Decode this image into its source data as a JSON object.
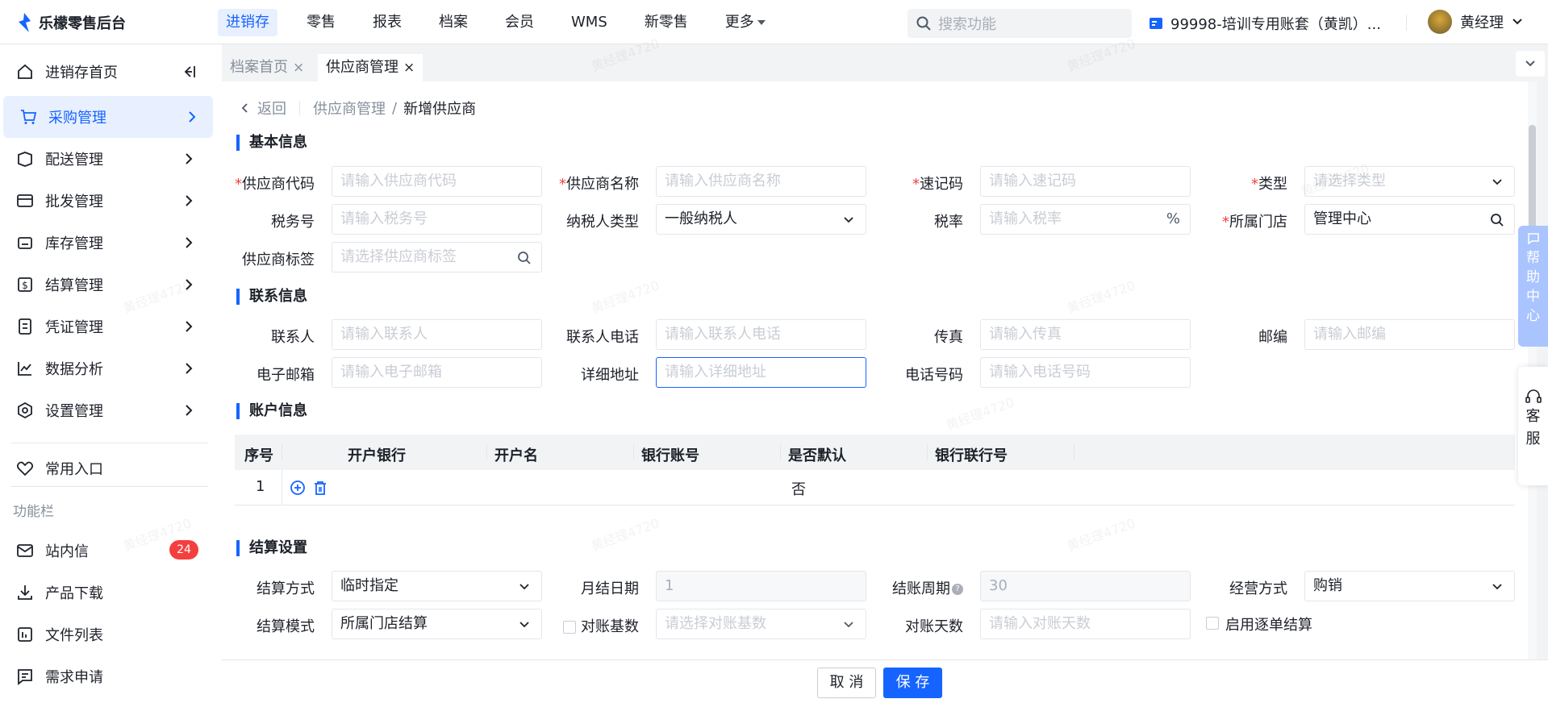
{
  "app": {
    "logo_text": "乐檬零售后台"
  },
  "topnav": {
    "items": [
      "进销存",
      "零售",
      "报表",
      "档案",
      "会员",
      "WMS",
      "新零售",
      "更多"
    ],
    "search_placeholder": "搜索功能",
    "account": "99998-培训专用账套（黄凯）...",
    "user": "黄经理"
  },
  "sidebar": {
    "items": [
      {
        "label": "进销存首页",
        "icon": "home-icon"
      },
      {
        "label": "采购管理",
        "icon": "cart-icon"
      },
      {
        "label": "配送管理",
        "icon": "box-icon"
      },
      {
        "label": "批发管理",
        "icon": "card-icon"
      },
      {
        "label": "库存管理",
        "icon": "inventory-icon"
      },
      {
        "label": "结算管理",
        "icon": "dollar-icon"
      },
      {
        "label": "凭证管理",
        "icon": "doc-icon"
      },
      {
        "label": "数据分析",
        "icon": "chart-icon"
      },
      {
        "label": "设置管理",
        "icon": "settings-icon"
      }
    ],
    "favorites": "常用入口",
    "toolbar_label": "功能栏",
    "tools": [
      {
        "label": "站内信",
        "icon": "mail-icon",
        "badge": "24"
      },
      {
        "label": "产品下载",
        "icon": "download-icon"
      },
      {
        "label": "文件列表",
        "icon": "file-list-icon"
      },
      {
        "label": "需求申请",
        "icon": "request-icon"
      }
    ]
  },
  "tabs": [
    {
      "label": "档案首页",
      "close": "×"
    },
    {
      "label": "供应商管理",
      "close": "×"
    }
  ],
  "breadcrumb": {
    "back": "返回",
    "parent": "供应商管理",
    "sep": "/",
    "current": "新增供应商"
  },
  "sections": {
    "basic": "基本信息",
    "contact": "联系信息",
    "account": "账户信息",
    "settlement": "结算设置"
  },
  "basic": {
    "supplier_code": {
      "label": "供应商代码",
      "placeholder": "请输入供应商代码"
    },
    "supplier_name": {
      "label": "供应商名称",
      "placeholder": "请输入供应商名称"
    },
    "quick_code": {
      "label": "速记码",
      "placeholder": "请输入速记码"
    },
    "type": {
      "label": "类型",
      "placeholder": "请选择类型"
    },
    "tax_no": {
      "label": "税务号",
      "placeholder": "请输入税务号"
    },
    "taxpayer_type": {
      "label": "纳税人类型",
      "value": "一般纳税人"
    },
    "tax_rate": {
      "label": "税率",
      "placeholder": "请输入税率",
      "suffix": "%"
    },
    "store": {
      "label": "所属门店",
      "value": "管理中心"
    },
    "tag": {
      "label": "供应商标签",
      "placeholder": "请选择供应商标签"
    }
  },
  "contact": {
    "person": {
      "label": "联系人",
      "placeholder": "请输入联系人"
    },
    "phone": {
      "label": "联系人电话",
      "placeholder": "请输入联系人电话"
    },
    "fax": {
      "label": "传真",
      "placeholder": "请输入传真"
    },
    "zip": {
      "label": "邮编",
      "placeholder": "请输入邮编"
    },
    "email": {
      "label": "电子邮箱",
      "placeholder": "请输入电子邮箱"
    },
    "address": {
      "label": "详细地址",
      "placeholder": "请输入详细地址"
    },
    "tel": {
      "label": "电话号码",
      "placeholder": "请输入电话号码"
    }
  },
  "account_table": {
    "headers": [
      "序号",
      "开户银行",
      "开户名",
      "银行账号",
      "是否默认",
      "银行联行号"
    ],
    "rows": [
      {
        "index": "1",
        "default": "否"
      }
    ]
  },
  "settlement": {
    "method": {
      "label": "结算方式",
      "value": "临时指定"
    },
    "month_day": {
      "label": "月结日期",
      "value": "1"
    },
    "period": {
      "label": "结账周期",
      "value": "30"
    },
    "business": {
      "label": "经营方式",
      "value": "购销"
    },
    "mode": {
      "label": "结算模式",
      "value": "所属门店结算"
    },
    "recon_base": {
      "label": "对账基数",
      "placeholder": "请选择对账基数"
    },
    "recon_days": {
      "label": "对账天数",
      "placeholder": "请输入对账天数"
    },
    "single": {
      "label": "启用逐单结算"
    }
  },
  "buttons": {
    "cancel": "取 消",
    "save": "保 存"
  },
  "float": {
    "help": [
      "帮",
      "助",
      "中",
      "心"
    ],
    "service": [
      "客",
      "服"
    ]
  },
  "watermark": "黄经理4720",
  "colors": {
    "primary": "#1664ff",
    "danger": "#f53f3f"
  }
}
